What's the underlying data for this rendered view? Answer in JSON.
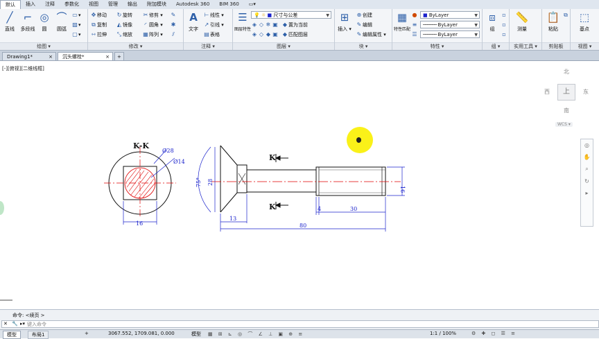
{
  "ribbon_tabs": [
    "默认",
    "插入",
    "注释",
    "参数化",
    "视图",
    "管理",
    "输出",
    "附加模块",
    "Autodesk 360",
    "BIM 360"
  ],
  "draw_panel": {
    "title": "绘图 ▾",
    "buttons": [
      "直线",
      "多段线",
      "圆",
      "圆弧"
    ]
  },
  "modify_panel": {
    "title": "修改 ▾",
    "items": [
      "移动",
      "旋转",
      "修剪",
      "复制",
      "镜像",
      "圆角",
      "拉伸",
      "缩放",
      "阵列"
    ]
  },
  "annotation_panel": {
    "title": "注释 ▾",
    "text_btn": "文字",
    "items": [
      "线性",
      "引线",
      "表格"
    ]
  },
  "layer_panel": {
    "title": "图层 ▾",
    "big_btn": "图层特性",
    "layer_name": "尺寸与公差",
    "items": [
      "置为当前",
      "匹配图层"
    ]
  },
  "block_panel": {
    "title": "块 ▾",
    "big_btn": "插入",
    "items": [
      "创建",
      "编辑",
      "编辑属性"
    ]
  },
  "props_panel": {
    "title": "特性 ▾",
    "big_btn": "特性匹配",
    "bylayer": [
      "ByLayer",
      "ByLayer",
      "ByLayer"
    ]
  },
  "group_panel": {
    "title": "组 ▾",
    "big_btn": "组"
  },
  "utility_panel": {
    "title": "实用工具 ▾",
    "big_btn": "测量"
  },
  "clipboard_panel": {
    "title": "剪贴板",
    "big_btn": "粘贴"
  },
  "view_panel": {
    "title": "视图 ▾",
    "big_btn": "基点"
  },
  "file_tabs": [
    "Drawing1*",
    "沉头螺栓*"
  ],
  "view_label": "[-][俯视][二维线框]",
  "viewcube": {
    "n": "北",
    "s": "南",
    "e": "东",
    "w": "西",
    "top": "上",
    "wcs": "WCS ▾"
  },
  "drawing": {
    "section_label": "K-K",
    "dia_outer": "Ø28",
    "dia_inner": "Ø14",
    "dim_16_left": "16",
    "angle": "75°",
    "dim_28": "28",
    "k_top": "K",
    "k_bottom": "K",
    "dim_13": "13",
    "dim_4": "4",
    "dim_30": "30",
    "dim_80": "80",
    "dim_16_right": "16"
  },
  "command": {
    "history": "命令: <续页 >",
    "prompt": "键入命令"
  },
  "status": {
    "model": "模型",
    "layout": "布局1",
    "coords": "3067.552, 1709.081, 0.000",
    "mode": "模型",
    "scale": "1:1 / 100%"
  },
  "colors": {
    "dim": "#1a22cc",
    "center": "#e00000",
    "outline": "#111111",
    "hatch": "#e00000"
  }
}
